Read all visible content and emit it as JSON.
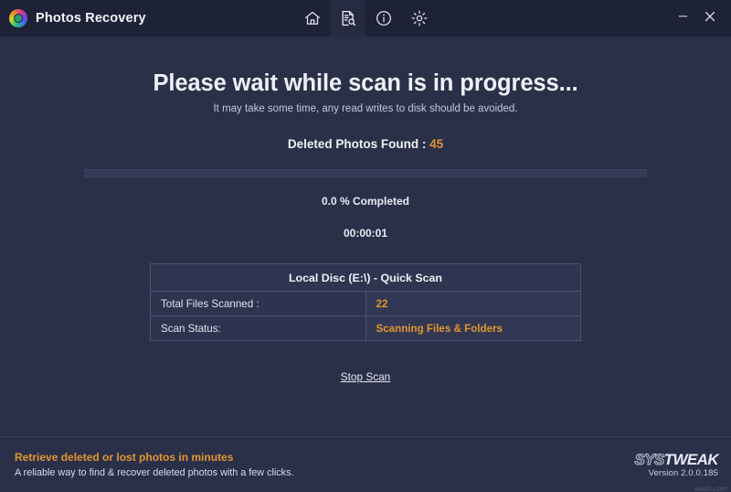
{
  "titlebar": {
    "app_name": "Photos Recovery",
    "logo_icon": "photos-recovery-logo-icon",
    "nav": [
      {
        "id": "home",
        "icon": "home-icon",
        "label": "Home",
        "active": false
      },
      {
        "id": "scan",
        "icon": "document-search-icon",
        "label": "Scan",
        "active": true
      },
      {
        "id": "info",
        "icon": "info-circle-icon",
        "label": "Info",
        "active": false
      },
      {
        "id": "settings",
        "icon": "gear-icon",
        "label": "Settings",
        "active": false
      }
    ],
    "window_controls": [
      {
        "id": "minimize",
        "icon": "minimize-icon",
        "label": "Minimize"
      },
      {
        "id": "close",
        "icon": "close-icon",
        "label": "Close"
      }
    ]
  },
  "main": {
    "heading": "Please wait while scan is in progress...",
    "subheading": "It may take some time, any read writes to disk should be avoided.",
    "found_label": "Deleted Photos Found :",
    "found_count": "45",
    "progress_percent": 0.0,
    "progress_text": "0.0 % Completed",
    "elapsed_time": "00:00:01",
    "stop_scan_label": "Stop Scan"
  },
  "scan_table": {
    "header": "Local Disc (E:\\) - Quick Scan",
    "rows": [
      {
        "label": "Total Files Scanned :",
        "value": "22"
      },
      {
        "label": "Scan Status:",
        "value": "Scanning Files & Folders"
      }
    ]
  },
  "footer": {
    "tagline": "Retrieve deleted or lost photos in minutes",
    "subtagline": "A reliable way to find & recover deleted photos with a few clicks.",
    "brand_prefix": "SYS",
    "brand_suffix": "TWEAK",
    "version": "Version 2.0.0.185",
    "watermark": "wsdn.com"
  },
  "colors": {
    "background": "#2b3049",
    "titlebar": "#1e2236",
    "accent_orange": "#e2952f",
    "text_primary": "#eef0f7",
    "border": "#4b5271"
  }
}
